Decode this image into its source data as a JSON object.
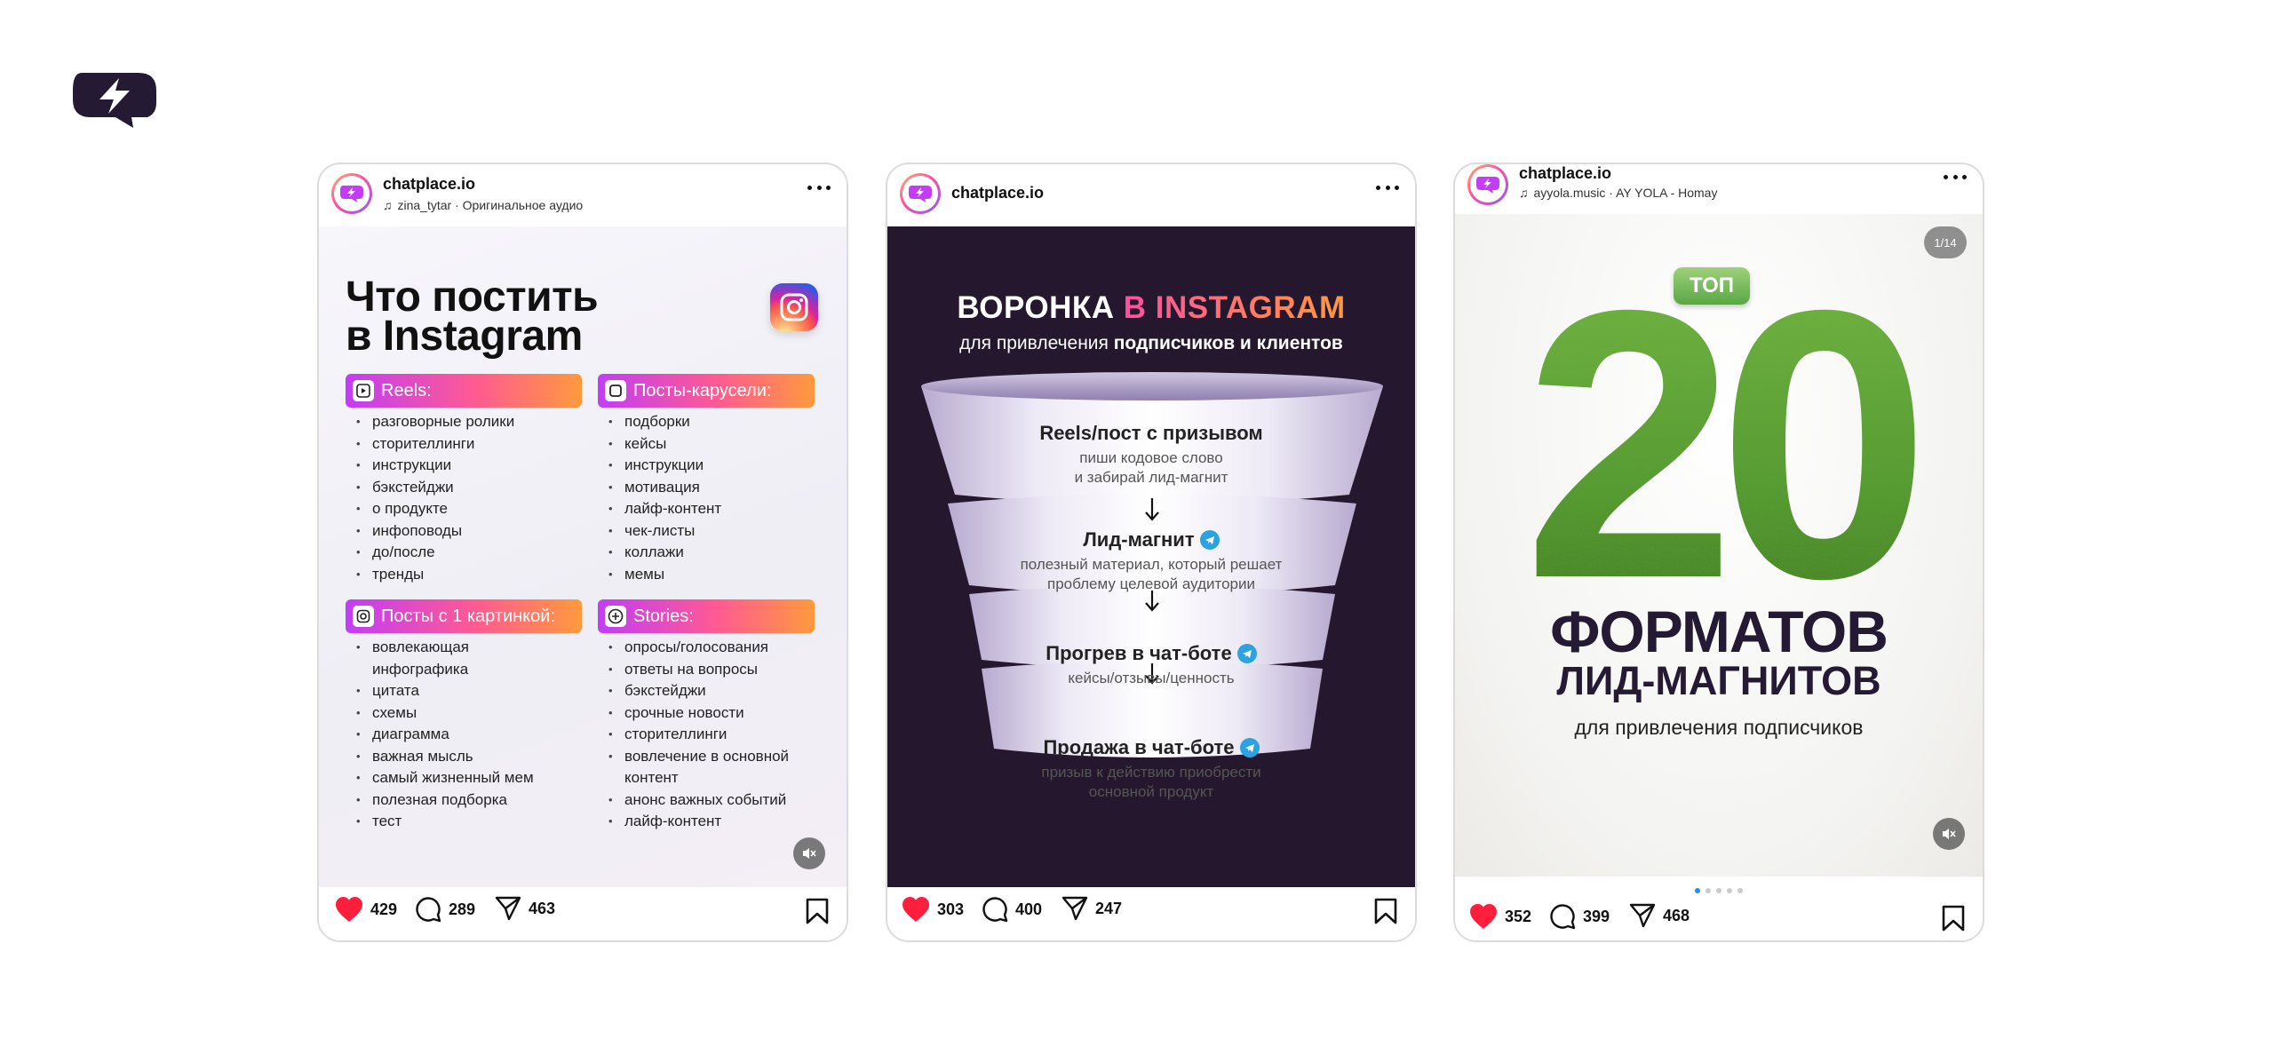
{
  "posts": [
    {
      "account": "chatplace.io",
      "audio": "zina_tytar · Оригинальное аудио",
      "likes": "429",
      "comments": "289",
      "shares": "463",
      "title_line1": "Что постить",
      "title_line2": "в Instagram",
      "sections": [
        {
          "label": "Reels:",
          "icon": "reels-icon",
          "items": [
            "разговорные ролики",
            "сторителлинги",
            "инструкции",
            "бэкстейджи",
            "о продукте",
            "инфоповоды",
            "до/после",
            "тренды"
          ]
        },
        {
          "label": "Посты-карусели:",
          "icon": "carousel-icon",
          "items": [
            "подборки",
            "кейсы",
            "инструкции",
            "мотивация",
            "лайф-контент",
            "чек-листы",
            "коллажи",
            "мемы"
          ]
        },
        {
          "label": "Посты с 1 картинкой:",
          "icon": "image-icon",
          "items": [
            "вовлекающая",
            "инфографика",
            "цитата",
            "схемы",
            "диаграмма",
            "важная мысль",
            "самый жизненный мем",
            "полезная подборка",
            "тест"
          ]
        },
        {
          "label": "Stories:",
          "icon": "plus-circle-icon",
          "items": [
            "опросы/голосования",
            "ответы на вопросы",
            "бэкстейджи",
            "срочные новости",
            "сторителлинги",
            "вовлечение в основной",
            "контент",
            "анонс важных событий",
            "лайф-контент"
          ]
        }
      ]
    },
    {
      "account": "chatplace.io",
      "likes": "303",
      "comments": "400",
      "shares": "247",
      "title_white": "ВОРОНКА ",
      "title_accent": "В INSTAGRAM",
      "subtitle_pre": "для привлечения ",
      "subtitle_bold": "подписчиков и клиентов",
      "stages": [
        {
          "title": "Reels/пост с призывом",
          "desc1": "пиши кодовое слово",
          "desc2": "и забирай лид-магнит"
        },
        {
          "title": "Лид-магнит",
          "desc1": "полезный материал, который решает",
          "desc2": "проблему целевой аудитории"
        },
        {
          "title": "Прогрев в чат-боте",
          "desc1": "кейсы/отзывы/ценность",
          "desc2": ""
        },
        {
          "title": "Продажа в чат-боте",
          "desc1": "призыв к действию приобрести",
          "desc2": "основной продукт"
        }
      ]
    },
    {
      "account": "chatplace.io",
      "audio": "ayyola.music · AY YOLA - Homay",
      "likes": "352",
      "comments": "399",
      "shares": "468",
      "page_indicator": "1/14",
      "badge": "ТОП",
      "big_number": "20",
      "title_line1": "ФОРМАТОВ",
      "title_line2": "ЛИД-МАГНИТОВ",
      "subtitle": "для привлечения подписчиков"
    }
  ],
  "colors": {
    "like_red": "#ff1f3d",
    "accent_pink": "#ff4fa0",
    "accent_orange": "#ff9a3c",
    "grass_green": "#4e9a2e",
    "funnel_bg": "#25182e"
  }
}
